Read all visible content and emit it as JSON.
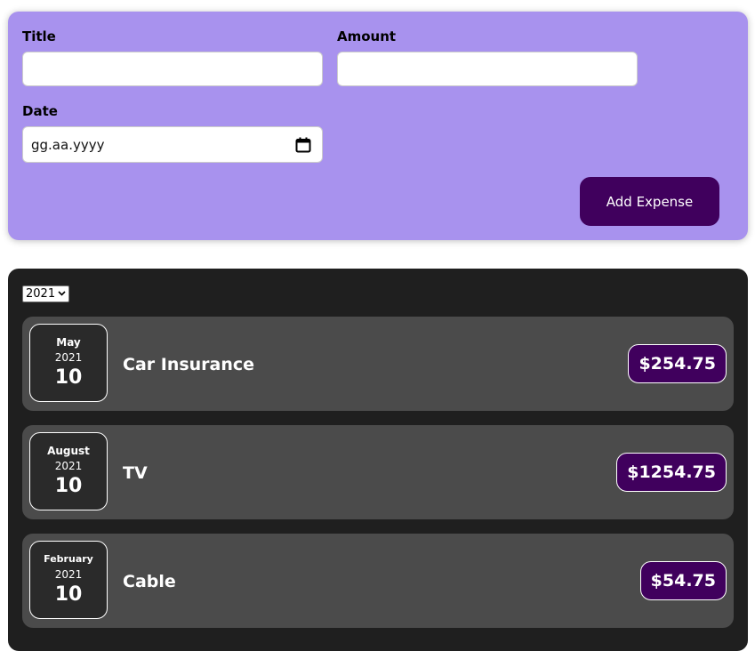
{
  "form": {
    "title_label": "Title",
    "title_value": "",
    "amount_label": "Amount",
    "amount_value": "",
    "date_label": "Date",
    "date_placeholder": "gg.aa.yyyy",
    "add_button_label": "Add Expense"
  },
  "filter": {
    "selected_year": "2021"
  },
  "expenses": [
    {
      "month": "May",
      "year": "2021",
      "day": "10",
      "title": "Car Insurance",
      "amount": "$254.75"
    },
    {
      "month": "August",
      "year": "2021",
      "day": "10",
      "title": "TV",
      "amount": "$1254.75"
    },
    {
      "month": "February",
      "year": "2021",
      "day": "10",
      "title": "Cable",
      "amount": "$54.75"
    }
  ],
  "colors": {
    "form_background": "#a892ee",
    "accent": "#40005d",
    "list_background": "#1f1f1f",
    "item_background": "#4b4b4b"
  }
}
